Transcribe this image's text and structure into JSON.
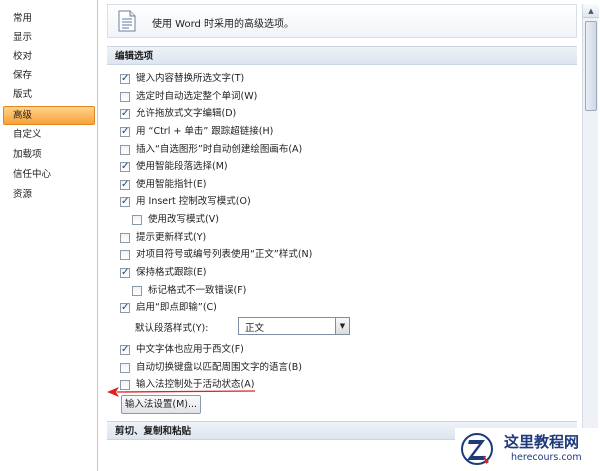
{
  "nav": {
    "items": [
      {
        "label": "常用",
        "active": false
      },
      {
        "label": "显示",
        "active": false
      },
      {
        "label": "校对",
        "active": false
      },
      {
        "label": "保存",
        "active": false
      },
      {
        "label": "版式",
        "active": false
      },
      {
        "label": "高级",
        "active": true
      },
      {
        "label": "自定义",
        "active": false
      },
      {
        "label": "加载项",
        "active": false
      },
      {
        "label": "信任中心",
        "active": false
      },
      {
        "label": "资源",
        "active": false
      }
    ]
  },
  "header": {
    "title": "使用 Word 时采用的高级选项。"
  },
  "sections": {
    "editing": "编辑选项",
    "cut_copy_paste": "剪切、复制和粘贴"
  },
  "options": [
    {
      "label": "键入内容替换所选文字(T)",
      "checked": true
    },
    {
      "label": "选定时自动选定整个单词(W)",
      "checked": false
    },
    {
      "label": "允许拖放式文字编辑(D)",
      "checked": true
    },
    {
      "label": "用 “Ctrl + 单击” 跟踪超链接(H)",
      "checked": true
    },
    {
      "label": "插入“自选图形”时自动创建绘图画布(A)",
      "checked": false
    },
    {
      "label": "使用智能段落选择(M)",
      "checked": true
    },
    {
      "label": "使用智能指针(E)",
      "checked": true
    },
    {
      "label": "用 Insert 控制改写模式(O)",
      "checked": true
    },
    {
      "label": "使用改写模式(V)",
      "checked": false
    },
    {
      "label": "提示更新样式(Y)",
      "checked": false
    },
    {
      "label": "对项目符号或编号列表使用“正文”样式(N)",
      "checked": false
    },
    {
      "label": "保持格式跟踪(E)",
      "checked": true
    },
    {
      "label": "标记格式不一致错误(F)",
      "checked": false
    },
    {
      "label": "启用“即点即输”(C)",
      "checked": true
    },
    {
      "label": "中文字体也应用于西文(F)",
      "checked": true
    },
    {
      "label": "自动切换键盘以匹配周围文字的语言(B)",
      "checked": false
    },
    {
      "label": "输入法控制处于活动状态(A)",
      "checked": false
    }
  ],
  "default_paragraph": {
    "label": "默认段落样式(Y):",
    "value": "正文"
  },
  "ime_button": {
    "label": "输入法设置(M)..."
  },
  "colors": {
    "accent": "#f7a23b",
    "arrow": "#e02020",
    "check": "#27466b"
  },
  "watermark": {
    "title": "这里教程网",
    "url": "herecours.com"
  }
}
